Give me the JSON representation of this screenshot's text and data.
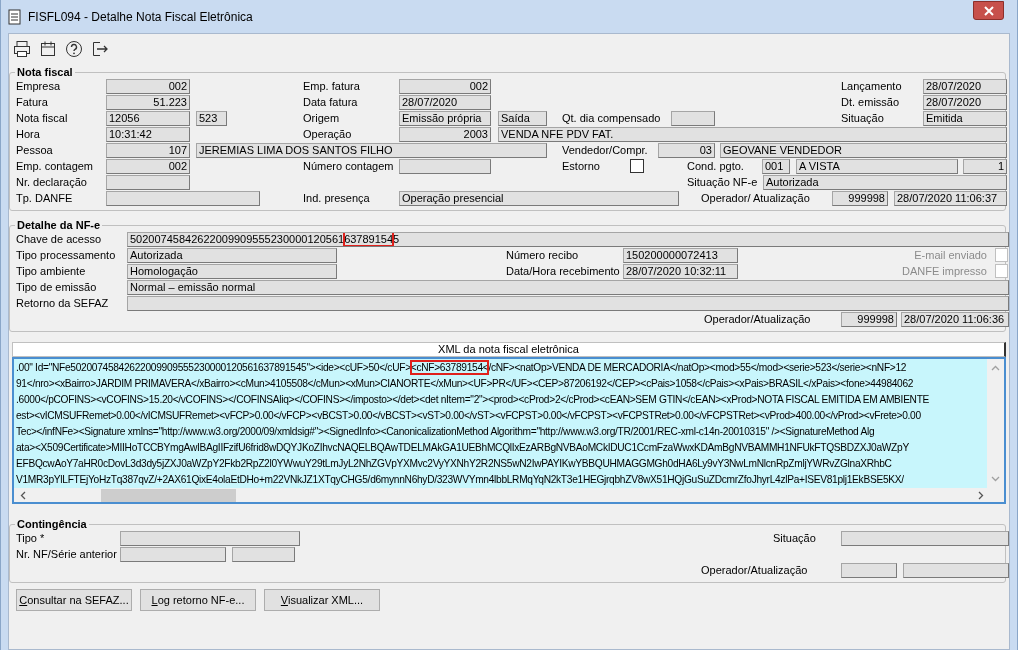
{
  "window": {
    "title": "FISFL094 - Detalhe Nota Fiscal Eletrônica"
  },
  "nota_fiscal": {
    "legend": "Nota fiscal",
    "items": [
      {
        "label": "Empresa",
        "fields": [
          {
            "kind": "field",
            "value": "002"
          }
        ]
      },
      {
        "label": "Emp. fatura",
        "fields": [
          {
            "kind": "field",
            "value": "002"
          }
        ]
      },
      {
        "label": "Lançamento",
        "fields": [
          {
            "kind": "field",
            "value": "28/07/2020"
          }
        ]
      },
      {
        "label": "Fatura",
        "fields": [
          {
            "kind": "field",
            "value": "51.223"
          }
        ]
      },
      {
        "label": "Data fatura",
        "fields": [
          {
            "kind": "field",
            "value": "28/07/2020"
          }
        ]
      },
      {
        "label": "Dt. emissão",
        "fields": [
          {
            "kind": "field",
            "value": "28/07/2020"
          }
        ]
      },
      {
        "label": "Nota fiscal",
        "fields": [
          {
            "kind": "field",
            "value": "12056"
          },
          {
            "kind": "field",
            "value": "523"
          }
        ]
      },
      {
        "label": "Origem",
        "fields": [
          {
            "kind": "field",
            "value": "Emissão própria"
          },
          {
            "kind": "field",
            "value": "Saída"
          }
        ]
      },
      {
        "label": "Qt. dia compensado",
        "fields": [
          {
            "kind": "field"
          }
        ]
      },
      {
        "label": "Situação",
        "fields": [
          {
            "kind": "field",
            "value": "Emitida"
          }
        ]
      },
      {
        "label": "Hora",
        "fields": [
          {
            "kind": "field",
            "value": "10:31:42"
          }
        ]
      },
      {
        "label": "Operação",
        "fields": [
          {
            "kind": "field",
            "value": "2003"
          },
          {
            "kind": "field",
            "value": "VENDA NFE PDV FAT."
          }
        ]
      },
      {
        "label": "Pessoa",
        "fields": [
          {
            "kind": "field",
            "value": "107"
          },
          {
            "kind": "field",
            "value": "JEREMIAS LIMA DOS SANTOS FILHO"
          }
        ]
      },
      {
        "label": "Vendedor/Compr.",
        "fields": [
          {
            "kind": "field",
            "value": "03"
          },
          {
            "kind": "field",
            "value": "GEOVANE VENDEDOR"
          }
        ]
      },
      {
        "label": "Emp. contagem",
        "fields": [
          {
            "kind": "field",
            "value": "002"
          }
        ]
      },
      {
        "label": "Número contagem",
        "fields": [
          {
            "kind": "field"
          }
        ]
      },
      {
        "label": "Estorno",
        "fields": [
          {
            "kind": "checkbox",
            "checked": false
          }
        ]
      },
      {
        "label": "Cond. pgto.",
        "fields": [
          {
            "kind": "field",
            "value": "001"
          },
          {
            "kind": "field",
            "value": "A VISTA"
          },
          {
            "kind": "field",
            "value": "1"
          }
        ]
      },
      {
        "label": "Nr. declaração",
        "fields": [
          {
            "kind": "field"
          }
        ]
      },
      {
        "label": "Situação NF-e",
        "fields": [
          {
            "kind": "field",
            "value": "Autorizada"
          }
        ]
      },
      {
        "label": "Tp. DANFE",
        "fields": [
          {
            "kind": "field"
          }
        ]
      },
      {
        "label": "Ind. presença",
        "fields": [
          {
            "kind": "field",
            "value": "Operação presencial"
          }
        ]
      },
      {
        "label": "Operador/ Atualização",
        "fields": [
          {
            "kind": "field",
            "value": "999998"
          },
          {
            "kind": "field",
            "value": "28/07/2020 11:06:37"
          }
        ]
      }
    ]
  },
  "detalhe_nfe": {
    "legend": "Detalhe da NF-e",
    "items": [
      {
        "label": "Chave de acesso",
        "fields": [
          {
            "kind": "field",
            "parts": [
              {
                "text": "50200745842622009909555230000120561",
                "highlighted": false
              },
              {
                "text": "63789154",
                "highlighted": true
              },
              {
                "text": "5",
                "highlighted": false
              }
            ]
          }
        ]
      },
      {
        "label": "Tipo processamento",
        "fields": [
          {
            "kind": "field",
            "value": "Autorizada"
          }
        ]
      },
      {
        "label": "Número recibo",
        "fields": [
          {
            "kind": "field",
            "value": "150200000072413"
          }
        ]
      },
      {
        "label": "E-mail enviado",
        "disabled": true,
        "fields": [
          {
            "kind": "checkbox",
            "checked": false
          }
        ]
      },
      {
        "label": "Tipo ambiente",
        "fields": [
          {
            "kind": "field",
            "value": "Homologação"
          }
        ]
      },
      {
        "label": "Data/Hora recebimento",
        "fields": [
          {
            "kind": "field",
            "value": "28/07/2020 10:32:11"
          }
        ]
      },
      {
        "label": "DANFE impresso",
        "disabled": true,
        "fields": [
          {
            "kind": "checkbox",
            "checked": false
          }
        ]
      },
      {
        "label": "Tipo de emissão",
        "fields": [
          {
            "kind": "field",
            "value": "Normal – emissão normal"
          }
        ]
      },
      {
        "label": "Retorno da SEFAZ",
        "fields": [
          {
            "kind": "field"
          }
        ]
      },
      {
        "label": "Operador/Atualização",
        "fields": [
          {
            "kind": "field",
            "value": "999998"
          },
          {
            "kind": "field",
            "value": "28/07/2020 11:06:36"
          }
        ]
      }
    ]
  },
  "xml_panel": {
    "header": "XML da nota fiscal eletrônica",
    "lines": [
      {
        "parts": [
          {
            "text": ".00\" Id=\"NFe50200745842622009909555230000120561637891545\"><ide><cUF>50</cUF>",
            "highlighted": false
          },
          {
            "text": "<cNF>63789154<",
            "highlighted": true
          },
          {
            "text": "/cNF><natOp>VENDA DE MERCADORIA</natOp><mod>55</mod><serie>523</serie><nNF>12",
            "highlighted": false
          }
        ]
      },
      {
        "parts": [
          {
            "text": "91</nro><xBairro>JARDIM PRIMAVERA</xBairro><cMun>4105508</cMun><xMun>CIANORTE</xMun><UF>PR</UF><CEP>87206192</CEP><cPais>1058</cPais><xPais>BRASIL</xPais><fone>44984062",
            "highlighted": false
          }
        ]
      },
      {
        "parts": [
          {
            "text": ".6000</pCOFINS><vCOFINS>15.20</vCOFINS></COFINSAliq></COFINS></imposto></det><det nItem=\"2\"><prod><cProd>2</cProd><cEAN>SEM GTIN</cEAN><xProd>NOTA FISCAL EMITIDA EM AMBIENTE",
            "highlighted": false
          }
        ]
      },
      {
        "parts": [
          {
            "text": "est><vICMSUFRemet>0.00</vICMSUFRemet><vFCP>0.00</vFCP><vBCST>0.00</vBCST><vST>0.00</vST><vFCPST>0.00</vFCPST><vFCPSTRet>0.00</vFCPSTRet><vProd>400.00</vProd><vFrete>0.00",
            "highlighted": false
          }
        ]
      },
      {
        "parts": [
          {
            "text": "Tec></infNFe><Signature xmlns=\"http://www.w3.org/2000/09/xmldsig#\"><SignedInfo><CanonicalizationMethod Algorithm=\"http://www.w3.org/TR/2001/REC-xml-c14n-20010315\" /><SignatureMethod Alg",
            "highlighted": false
          }
        ]
      },
      {
        "parts": [
          {
            "text": "ata><X509Certificate>MIIHoTCCBYmgAwIBAgIIFzifU6frid8wDQYJKoZIhvcNAQELBQAwTDELMAkGA1UEBhMCQlIxEzARBgNVBAoMCkIDUC1CcmFzaWwxKDAmBgNVBAMMH1NFUkFTQSBDZXJ0aWZpY",
            "highlighted": false
          }
        ]
      },
      {
        "parts": [
          {
            "text": "EFBQcwAoY7aHR0cDovL3d3dy5jZXJ0aWZpY2Fkb2RpZ2l0YWwuY29tLmJyL2NhZGVpYXMvc2VyYXNhY2R2NS5wN2IwPAYIKwYBBQUHMAGGMGh0dHA6Ly9vY3NwLmNlcnRpZmljYWRvZGlnaXRhbC",
            "highlighted": false
          }
        ]
      },
      {
        "parts": [
          {
            "text": "V1MR3pYlLFTEjYoHzTq387qvZ/+2AX61QixE4olaEtDHo+m22VNkJZ1XTqyCHG5/d6mynnN6hyD/323WVYmn4lbbLRMqYqN2kT3e1HEGjrqbhZV8wX51HQjGuSuZDcmrZfoJhyrL4zlPa+ISEV81plj1EkBSE5KX/",
            "highlighted": false
          }
        ]
      }
    ]
  },
  "contingencia": {
    "legend": "Contingência",
    "items": [
      {
        "label": "Tipo *",
        "fields": [
          {
            "kind": "field"
          }
        ]
      },
      {
        "label": "Situação",
        "fields": [
          {
            "kind": "field"
          }
        ]
      },
      {
        "label": "Nr. NF/Série anterior",
        "fields": [
          {
            "kind": "field"
          },
          {
            "kind": "field"
          }
        ]
      },
      {
        "label": "Operador/Atualização",
        "fields": [
          {
            "kind": "field"
          },
          {
            "kind": "field"
          }
        ]
      }
    ]
  },
  "buttons": [
    {
      "label": "Consultar na SEFAZ..."
    },
    {
      "label": "Log retorno NF-e..."
    },
    {
      "label": "Visualizar XML..."
    }
  ]
}
